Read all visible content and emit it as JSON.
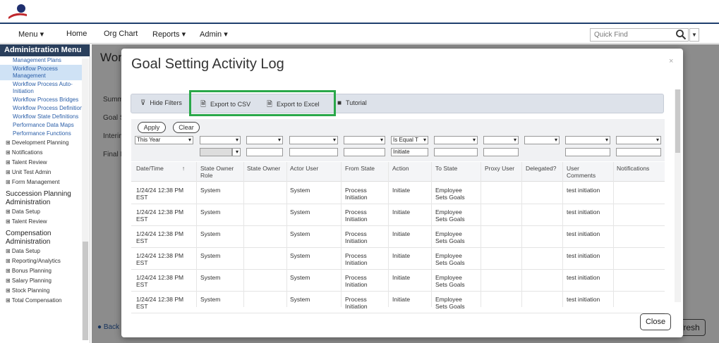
{
  "nav": {
    "items": [
      "Menu ▾",
      "Home",
      "Org Chart",
      "Reports ▾",
      "Admin ▾"
    ],
    "quick_find_placeholder": "Quick Find"
  },
  "sidebar": {
    "title": "Administration Menu",
    "links": [
      "Management Plans",
      "Workflow Process Management",
      "Workflow Process Auto-Initiation",
      "Workflow Process Bridges",
      "Workflow Process Definitions",
      "Workflow State Definitions",
      "Performance Data Maps",
      "Performance Functions"
    ],
    "tree_items": [
      "⊞ Development Planning",
      "⊞ Notifications",
      "⊞ Talent Review",
      "⊞ Unit Test Admin",
      "⊞ Form Management"
    ],
    "section2": "Succession Planning Administration",
    "section2_items": [
      "⊞ Data Setup",
      "⊞ Talent Review"
    ],
    "section3": "Compensation Administration",
    "section3_items": [
      "⊞ Data Setup",
      "⊞ Reporting/Analytics",
      "⊞ Bonus Planning",
      "⊞ Salary Planning",
      "⊞ Stock Planning",
      "⊞ Total Compensation"
    ]
  },
  "background": {
    "title": "Wor",
    "tabs": [
      "Summ",
      "Goal S",
      "Interim",
      "Final E"
    ],
    "back": "Back",
    "refresh": "fresh"
  },
  "modal": {
    "title": "Goal Setting Activity Log",
    "close_x": "×",
    "toolbar": {
      "hide_filters": "Hide Filters",
      "export_csv": "Export to CSV",
      "export_excel": "Export to Excel",
      "tutorial": "Tutorial"
    },
    "filters": {
      "apply": "Apply",
      "clear": "Clear",
      "date_range": "This Year",
      "action_op": "Is Equal T",
      "action_value": "Initiate"
    },
    "columns": [
      "Date/Time",
      "State Owner Role",
      "State Owner",
      "Actor User",
      "From State",
      "Action",
      "To State",
      "Proxy User",
      "Delegated?",
      "User Comments",
      "Notifications"
    ],
    "sort_icon": "↑",
    "rows": [
      {
        "date": "1/24/24 12:38 PM EST",
        "role": "System",
        "actor": "System",
        "from": "Process Initiation",
        "action": "Initiate",
        "to": "Employee Sets Goals",
        "comments": "test initiation"
      },
      {
        "date": "1/24/24 12:38 PM EST",
        "role": "System",
        "actor": "System",
        "from": "Process Initiation",
        "action": "Initiate",
        "to": "Employee Sets Goals",
        "comments": "test initiation"
      },
      {
        "date": "1/24/24 12:38 PM EST",
        "role": "System",
        "actor": "System",
        "from": "Process Initiation",
        "action": "Initiate",
        "to": "Employee Sets Goals",
        "comments": "test initiation"
      },
      {
        "date": "1/24/24 12:38 PM EST",
        "role": "System",
        "actor": "System",
        "from": "Process Initiation",
        "action": "Initiate",
        "to": "Employee Sets Goals",
        "comments": "test initiation"
      },
      {
        "date": "1/24/24 12:38 PM EST",
        "role": "System",
        "actor": "System",
        "from": "Process Initiation",
        "action": "Initiate",
        "to": "Employee Sets Goals",
        "comments": "test initiation"
      },
      {
        "date": "1/24/24 12:38 PM EST",
        "role": "System",
        "actor": "System",
        "from": "Process Initiation",
        "action": "Initiate",
        "to": "Employee Sets Goals",
        "comments": "test initiation"
      }
    ],
    "close_button": "Close"
  },
  "colors": {
    "highlight": "#2aa84a",
    "nav_border": "#1f3f6e",
    "sidebar_title": "#2a3f5c",
    "link": "#2a5ea8"
  }
}
